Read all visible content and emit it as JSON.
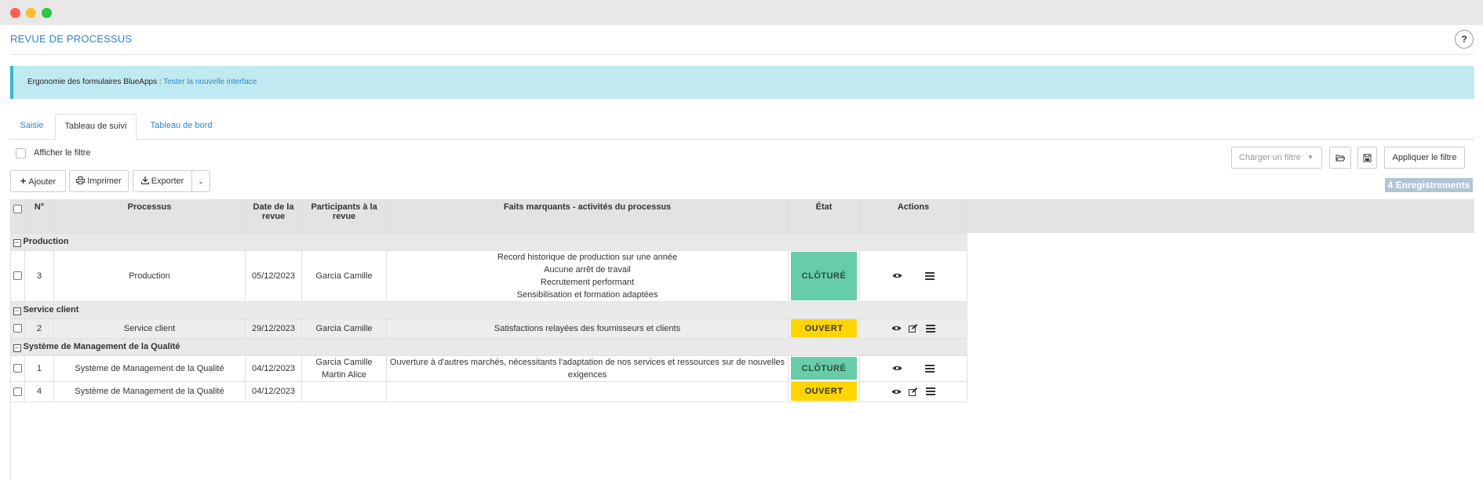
{
  "page": {
    "title": "REVUE DE PROCESSUS",
    "help": "?"
  },
  "alert": {
    "text": "Ergonomie des formulaires BlueApps : ",
    "link": "Tester la nouvelle interface"
  },
  "tabs": [
    {
      "label": "Saisie"
    },
    {
      "label": "Tableau de suivi"
    },
    {
      "label": "Tableau de bord"
    }
  ],
  "filter": {
    "show_label": "Afficher le filtre",
    "load_placeholder": "Charger un filtre",
    "apply_label": "Appliquer le filtre"
  },
  "toolbar": {
    "add": "Ajouter",
    "print": "Imprimer",
    "export": "Exporter"
  },
  "records": "4 Enregistrements",
  "columns": {
    "num": "N°",
    "process": "Processus",
    "date": "Date de la revue",
    "participants": "Participants à la revue",
    "facts": "Faits marquants - activités du processus",
    "state": "État",
    "actions": "Actions"
  },
  "groups": [
    {
      "name": "Production",
      "rows": [
        {
          "num": "3",
          "process": "Production",
          "date": "05/12/2023",
          "participants": [
            "Garcia Camille"
          ],
          "facts": [
            "Record historique de production sur une année",
            "Aucune arrêt de travail",
            "Recrutement performant",
            "Sensibilisation et formation adaptées"
          ],
          "state": "CLÔTURÉ"
        }
      ]
    },
    {
      "name": "Service client",
      "rows": [
        {
          "num": "2",
          "process": "Service client",
          "date": "29/12/2023",
          "participants": [
            "Garcia Camille"
          ],
          "facts": [
            "Satisfactions relayées des fournisseurs et clients"
          ],
          "state": "OUVERT"
        }
      ]
    },
    {
      "name": "Système de Management de la Qualité",
      "rows": [
        {
          "num": "1",
          "process": "Système de Management de la Qualité",
          "date": "04/12/2023",
          "participants": [
            "Garcia Camille",
            "Martin Alice"
          ],
          "facts": [
            "Ouverture à d'autres marchés, nécessitants l'adaptation de nos services et ressources sur de nouvelles exigences"
          ],
          "state": "CLÔTURÉ"
        },
        {
          "num": "4",
          "process": "Système de Management de la Qualité",
          "date": "04/12/2023",
          "participants": [],
          "facts": [],
          "state": "OUVERT"
        }
      ]
    }
  ],
  "colors": {
    "accent": "#2f86c8",
    "closed": "#67cca8",
    "open": "#ffd500",
    "alert_bg": "#c0eaf1"
  }
}
